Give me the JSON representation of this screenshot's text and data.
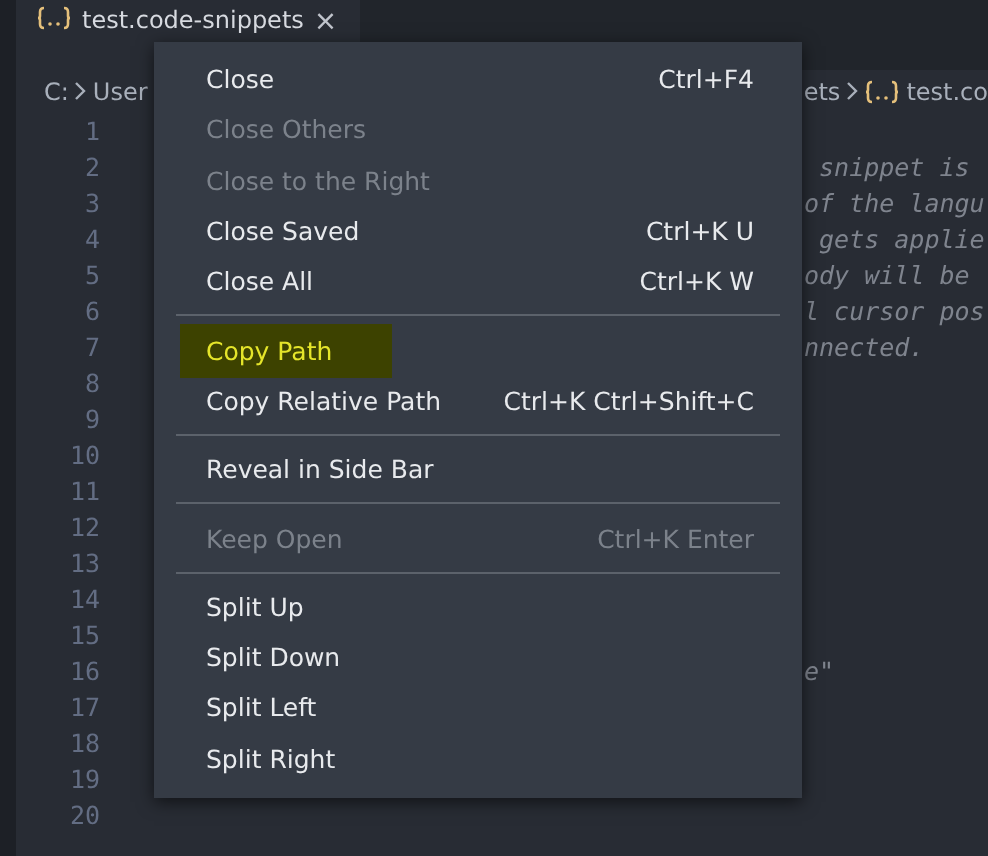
{
  "tab": {
    "title": "test.code-snippets",
    "close": "×"
  },
  "breadcrumbs": {
    "left": [
      "C:",
      "User"
    ],
    "right": [
      "ets",
      "test.co"
    ]
  },
  "lines": [
    {
      "number": "1"
    },
    {
      "number": "2",
      "text": " snippet is"
    },
    {
      "number": "3",
      "text": "of the langu"
    },
    {
      "number": "4",
      "text": " gets applie"
    },
    {
      "number": "5",
      "text": "ody will be"
    },
    {
      "number": "6",
      "text": "l cursor pos"
    },
    {
      "number": "7",
      "text": "nnected."
    },
    {
      "number": "8"
    },
    {
      "number": "9"
    },
    {
      "number": "10"
    },
    {
      "number": "11"
    },
    {
      "number": "12"
    },
    {
      "number": "13"
    },
    {
      "number": "14"
    },
    {
      "number": "15"
    },
    {
      "number": "16",
      "text": "e\""
    },
    {
      "number": "17"
    },
    {
      "number": "18"
    },
    {
      "number": "19"
    },
    {
      "number": "20"
    }
  ],
  "context_menu": [
    {
      "kind": "item",
      "label": "Close",
      "shortcut": "Ctrl+F4",
      "disabled": false,
      "selected": false
    },
    {
      "kind": "item",
      "label": "Close Others",
      "disabled": true,
      "selected": false
    },
    {
      "kind": "item",
      "label": "Close to the Right",
      "disabled": true,
      "selected": false
    },
    {
      "kind": "item",
      "label": "Close Saved",
      "shortcut": "Ctrl+K U",
      "disabled": false,
      "selected": false
    },
    {
      "kind": "item",
      "label": "Close All",
      "shortcut": "Ctrl+K W",
      "disabled": false,
      "selected": false
    },
    {
      "kind": "separator"
    },
    {
      "kind": "item",
      "label": "Copy Path",
      "disabled": false,
      "selected": true
    },
    {
      "kind": "item",
      "label": "Copy Relative Path",
      "shortcut": "Ctrl+K Ctrl+Shift+C",
      "disabled": false,
      "selected": false
    },
    {
      "kind": "separator"
    },
    {
      "kind": "item",
      "label": "Reveal in Side Bar",
      "disabled": false,
      "selected": false
    },
    {
      "kind": "separator"
    },
    {
      "kind": "item",
      "label": "Keep Open",
      "shortcut": "Ctrl+K Enter",
      "disabled": true,
      "selected": false
    },
    {
      "kind": "separator"
    },
    {
      "kind": "item",
      "label": "Split Up",
      "disabled": false,
      "selected": false
    },
    {
      "kind": "item",
      "label": "Split Down",
      "disabled": false,
      "selected": false
    },
    {
      "kind": "item",
      "label": "Split Left",
      "disabled": false,
      "selected": false
    },
    {
      "kind": "item",
      "label": "Split Right",
      "disabled": false,
      "selected": false
    }
  ]
}
